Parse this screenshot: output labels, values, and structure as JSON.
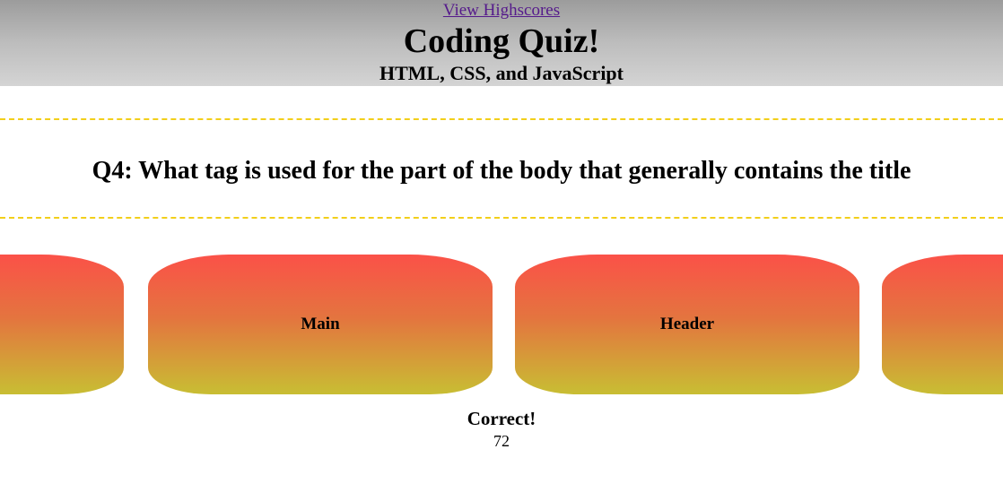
{
  "header": {
    "highscores_link": "View Highscores",
    "title": "Coding Quiz!",
    "subtitle": "HTML, CSS, and JavaScript"
  },
  "question": {
    "text": "Q4: What tag is used for the part of the body that generally contains the title"
  },
  "answers": [
    {
      "label": ""
    },
    {
      "label": "Main"
    },
    {
      "label": "Header"
    },
    {
      "label": ""
    }
  ],
  "result": {
    "feedback": "Correct!",
    "score": "72"
  },
  "colors": {
    "gradient_top": "#fb5148",
    "gradient_bottom": "#c8be33",
    "divider": "#f2cf1a",
    "link": "#551a8b"
  }
}
